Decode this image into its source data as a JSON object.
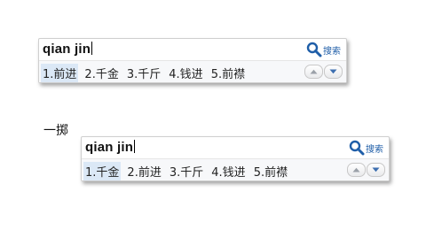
{
  "ime_top": {
    "composition": "qian jin",
    "search_label": "搜索",
    "candidates": [
      {
        "index": "1.",
        "text": "前进",
        "selected": true
      },
      {
        "index": "2.",
        "text": "千金",
        "selected": false
      },
      {
        "index": "3.",
        "text": "千斤",
        "selected": false
      },
      {
        "index": "4.",
        "text": "钱进",
        "selected": false
      },
      {
        "index": "5.",
        "text": "前襟",
        "selected": false
      }
    ]
  },
  "side_text": "一掷",
  "ime_bottom": {
    "composition": "qian jin",
    "search_label": "搜索",
    "candidates": [
      {
        "index": "1.",
        "text": "千金",
        "selected": true
      },
      {
        "index": "2.",
        "text": "前进",
        "selected": false
      },
      {
        "index": "3.",
        "text": "千斤",
        "selected": false
      },
      {
        "index": "4.",
        "text": "钱进",
        "selected": false
      },
      {
        "index": "5.",
        "text": "前襟",
        "selected": false
      }
    ]
  },
  "icons": {
    "search": "magnifier-icon",
    "page_up": "chevron-up-icon",
    "page_down": "chevron-down-icon"
  },
  "colors": {
    "accent": "#1f5ea8",
    "selection": "#dbe8f6"
  }
}
